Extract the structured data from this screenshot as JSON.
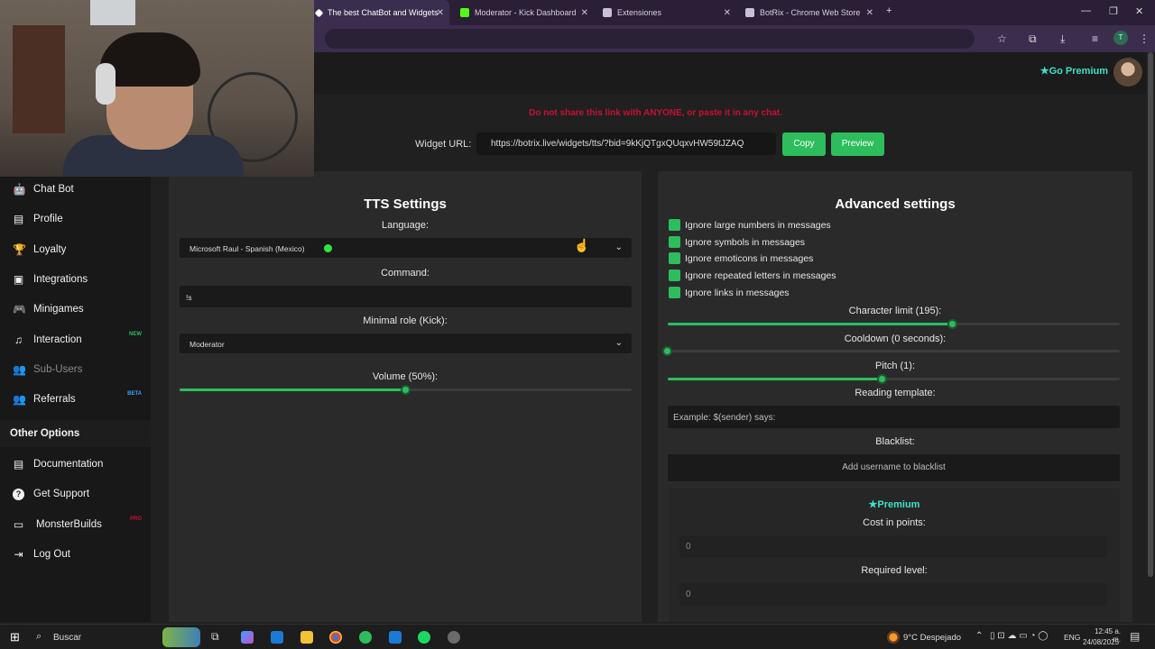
{
  "browser": {
    "tabs": [
      {
        "title": "The best ChatBot and Widgets",
        "active": true,
        "favicon_color": "#ffffff"
      },
      {
        "title": "Moderator - Kick Dashboard",
        "active": false,
        "favicon_color": "#53fc18"
      },
      {
        "title": "Extensiones",
        "active": false,
        "favicon_color": "#c9bfd6"
      },
      {
        "title": "BotRix - Chrome Web Store",
        "active": false,
        "favicon_color": "#c9bfd6"
      }
    ],
    "profile_initial": "T"
  },
  "header": {
    "go_premium": "Go Premium"
  },
  "widget": {
    "warning": "Do not share this link with ANYONE, or paste it in any chat.",
    "url_label": "Widget URL:",
    "url_value": "https://botrix.live/widgets/tts/?bid=9kKjQTgxQUqxvHW59tJZAQ",
    "copy_label": "Copy",
    "preview_label": "Preview"
  },
  "sidebar": {
    "items": [
      {
        "label": "Chat Bot",
        "icon": "robot-icon",
        "glyph": "🤖"
      },
      {
        "label": "Profile",
        "icon": "id-card-icon",
        "glyph": "▤"
      },
      {
        "label": "Loyalty",
        "icon": "trophy-icon",
        "glyph": "🏆"
      },
      {
        "label": "Integrations",
        "icon": "window-icon",
        "glyph": "▣"
      },
      {
        "label": "Minigames",
        "icon": "gamepad-icon",
        "glyph": "🎮"
      },
      {
        "label": "Interaction",
        "icon": "music-icon",
        "glyph": "♫",
        "badge": "NEW",
        "badge_color": "#2ebd5c"
      },
      {
        "label": "Sub-Users",
        "icon": "users-icon",
        "glyph": "👥",
        "disabled": true
      },
      {
        "label": "Referrals",
        "icon": "users-icon",
        "glyph": "👥",
        "badge": "BETA",
        "badge_color": "#3aa0ff"
      }
    ],
    "other_options_title": "Other Options",
    "other_items": [
      {
        "label": "Documentation",
        "icon": "book-icon",
        "glyph": "▤"
      },
      {
        "label": "Get Support",
        "icon": "question-icon",
        "glyph": "?"
      },
      {
        "label": "MonsterBuilds",
        "icon": "laptop-icon",
        "glyph": "▭",
        "badge": "PRO",
        "badge_color": "#c8102e"
      },
      {
        "label": "Log Out",
        "icon": "logout-icon",
        "glyph": "⇥"
      }
    ]
  },
  "tts": {
    "title": "TTS Settings",
    "language_label": "Language:",
    "language_value": "Microsoft Raul - Spanish (Mexico)",
    "command_label": "Command:",
    "command_value": "!s",
    "role_label": "Minimal role (Kick):",
    "role_value": "Moderator",
    "volume_label": "Volume (50%):",
    "volume": 0.5
  },
  "advanced": {
    "title": "Advanced settings",
    "checks": [
      "Ignore large numbers in messages",
      "Ignore symbols in messages",
      "Ignore emoticons in messages",
      "Ignore repeated letters in messages",
      "Ignore links in messages"
    ],
    "char_limit_label": "Character limit (195):",
    "char_limit_fraction": 0.63,
    "cooldown_label": "Cooldown (0 seconds):",
    "cooldown_fraction": 0,
    "pitch_label": "Pitch (1):",
    "pitch_fraction": 0.475,
    "template_label": "Reading template:",
    "template_placeholder": "Example: $(sender) says:",
    "blacklist_label": "Blacklist:",
    "blacklist_placeholder": "Add username to blacklist",
    "premium_title": "Premium",
    "cost_label": "Cost in points:",
    "cost_value": "0",
    "level_label": "Required level:",
    "level_value": "0"
  },
  "taskbar": {
    "search": "Buscar",
    "weather": "9°C  Despejado",
    "lang": "ENG",
    "time": "12:45 a. m.",
    "date": "24/08/2025"
  }
}
